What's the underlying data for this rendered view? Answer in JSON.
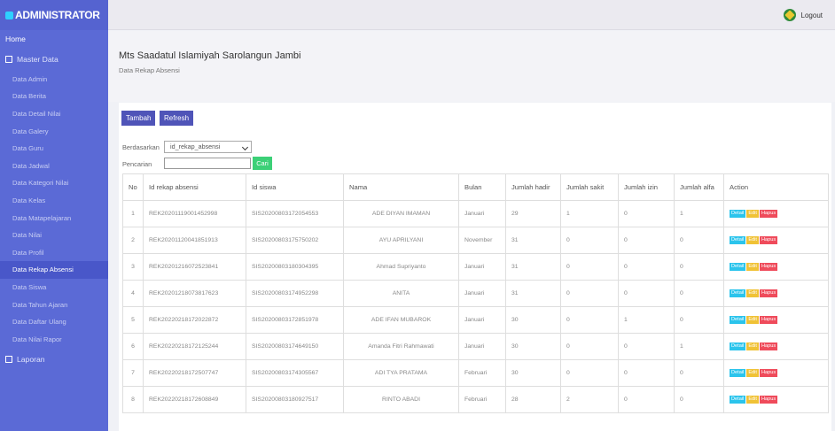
{
  "sidebar": {
    "brand": "ADMINISTRATOR",
    "home": "Home",
    "master": "Master Data",
    "items": [
      "Data Admin",
      "Data Berita",
      "Data Detail Nilai",
      "Data Galery",
      "Data Guru",
      "Data Jadwal",
      "Data Kategori Nilai",
      "Data Kelas",
      "Data Matapelajaran",
      "Data Nilai",
      "Data Profil",
      "Data Rekap Absensi",
      "Data Siswa",
      "Data Tahun Ajaran",
      "Data Daftar Ulang",
      "Data Nilai Rapor"
    ],
    "active_item": "Data Rekap Absensi",
    "bottom": "Laporan"
  },
  "topbar": {
    "logout": "Logout"
  },
  "header": {
    "school": "Mts Saadatul Islamiyah Sarolangun Jambi",
    "subtitle": "Data Rekap Absensi"
  },
  "toolbar": {
    "tambah": "Tambah",
    "refresh": "Refresh"
  },
  "filter": {
    "by_label": "Berdasarkan",
    "by_value": "id_rekap_absensi",
    "search_label": "Pencarian",
    "search_value": "",
    "search_button": "Cari"
  },
  "table": {
    "columns": [
      "No",
      "Id rekap absensi",
      "Id siswa",
      "Nama",
      "Bulan",
      "Jumlah hadir",
      "Jumlah sakit",
      "Jumlah izin",
      "Jumlah alfa",
      "Action"
    ],
    "actions": {
      "detail": "Detail",
      "edit": "Edit",
      "hapus": "Hapus"
    },
    "rows": [
      [
        "1",
        "REK20201119001452998",
        "SIS20200803172054553",
        "ADE DIYAN IMAMAN",
        "Januari",
        "29",
        "1",
        "0",
        "1"
      ],
      [
        "2",
        "REK20201120041851913",
        "SIS20200803175750202",
        "AYU APRILYANI",
        "November",
        "31",
        "0",
        "0",
        "0"
      ],
      [
        "3",
        "REK20201216072523841",
        "SIS20200803180304395",
        "Ahmad Supriyanto",
        "Januari",
        "31",
        "0",
        "0",
        "0"
      ],
      [
        "4",
        "REK20201218073817623",
        "SIS20200803174952298",
        "ANITA",
        "Januari",
        "31",
        "0",
        "0",
        "0"
      ],
      [
        "5",
        "REK20220218172022872",
        "SIS20200803172851978",
        "ADE IFAN MUBAROK",
        "Januari",
        "30",
        "0",
        "1",
        "0"
      ],
      [
        "6",
        "REK20220218172125244",
        "SIS20200803174649150",
        "Amanda Fitri Rahmawati",
        "Januari",
        "30",
        "0",
        "0",
        "1"
      ],
      [
        "7",
        "REK20220218172507747",
        "SIS20200803174305567",
        "ADI TYA PRATAMA",
        "Februari",
        "30",
        "0",
        "0",
        "0"
      ],
      [
        "8",
        "REK20220218172608849",
        "SIS20200803180927517",
        "RINTO ABADI",
        "Februari",
        "28",
        "2",
        "0",
        "0"
      ]
    ]
  }
}
